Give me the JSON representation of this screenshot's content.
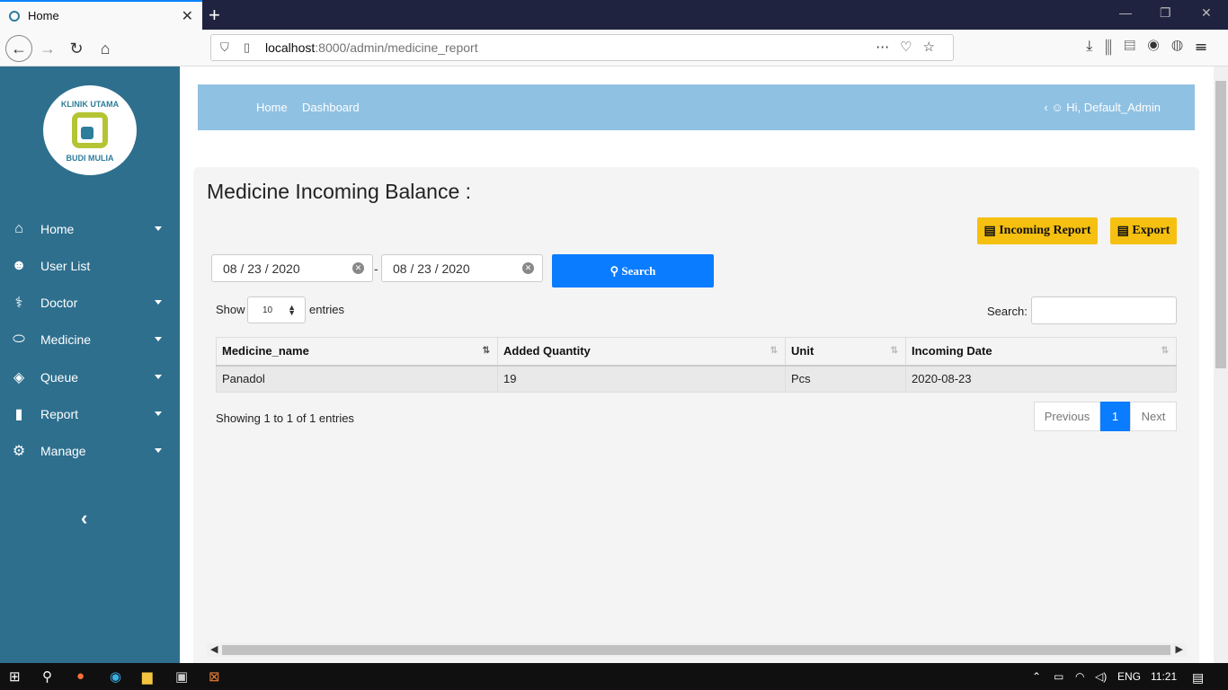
{
  "browser": {
    "tab_title": "Home",
    "url_host": "localhost",
    "url_path": ":8000/admin/medicine_report"
  },
  "sidebar": {
    "logo_text_top": "KLINIK UTAMA",
    "logo_text_bottom": "BUDI MULIA",
    "items": [
      {
        "label": "Home",
        "icon": "home-icon",
        "caret": true
      },
      {
        "label": "User List",
        "icon": "users-icon",
        "caret": false
      },
      {
        "label": "Doctor",
        "icon": "doctor-icon",
        "caret": true
      },
      {
        "label": "Medicine",
        "icon": "pills-icon",
        "caret": true
      },
      {
        "label": "Queue",
        "icon": "layers-icon",
        "caret": true
      },
      {
        "label": "Report",
        "icon": "clipboard-icon",
        "caret": true
      },
      {
        "label": "Manage",
        "icon": "gears-icon",
        "caret": true
      }
    ]
  },
  "topnav": {
    "home": "Home",
    "dashboard": "Dashboard",
    "greeting": "Hi, Default_Admin"
  },
  "panel": {
    "title": "Medicine Incoming Balance :",
    "incoming_report_btn": "Incoming Report",
    "export_btn": "Export",
    "date_from": "08 / 23 / 2020",
    "date_to": "08 / 23 / 2020",
    "dash": "-",
    "search_btn": "Search",
    "show_label": "Show",
    "entries_value": "10",
    "entries_label": "entries",
    "search_label": "Search:"
  },
  "table": {
    "headers": [
      "Medicine_name",
      "Added Quantity",
      "Unit",
      "Incoming Date"
    ],
    "rows": [
      [
        "Panadol",
        "19",
        "Pcs",
        "2020-08-23"
      ]
    ]
  },
  "footer": {
    "info": "Showing 1 to 1 of 1 entries",
    "previous": "Previous",
    "current_page": "1",
    "next": "Next"
  },
  "taskbar": {
    "lang": "ENG",
    "time": "11:21"
  }
}
